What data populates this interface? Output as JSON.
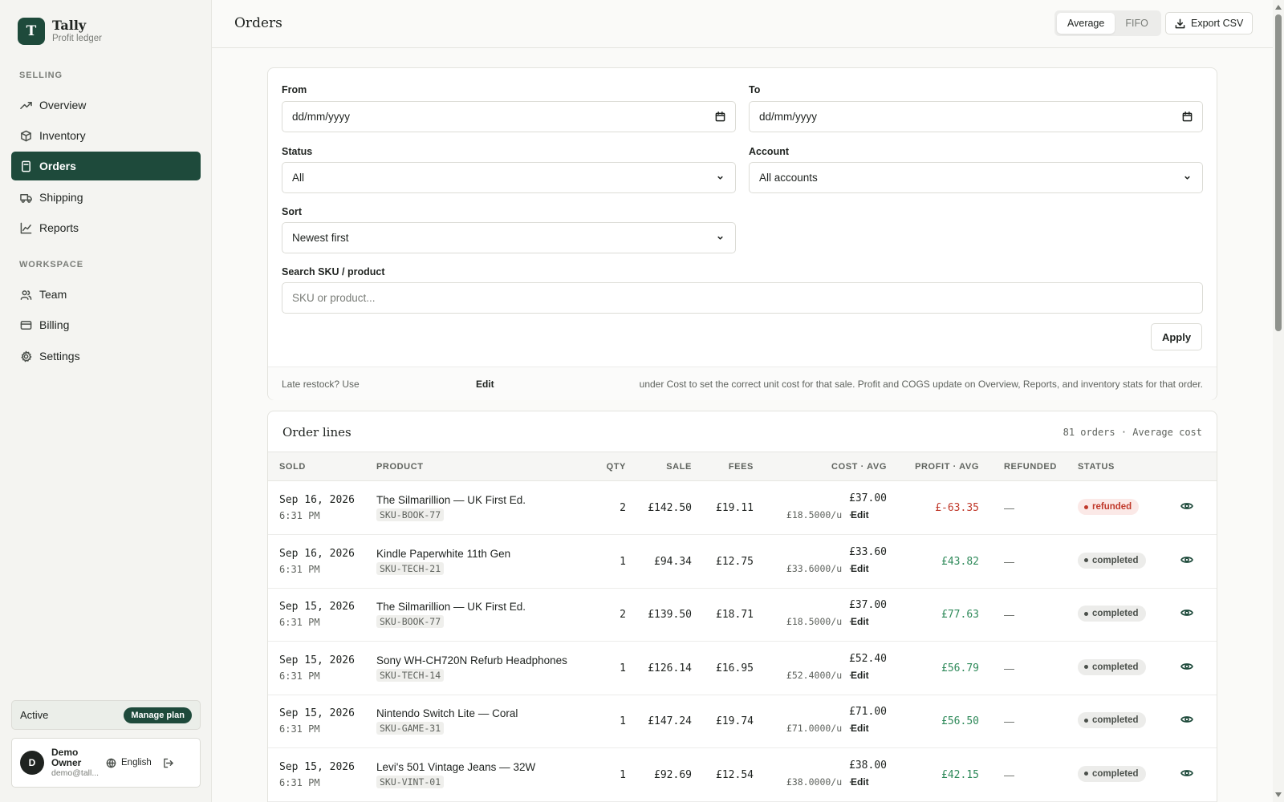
{
  "brand": {
    "logo_letter": "T",
    "name": "Tally",
    "subtitle": "Profit ledger"
  },
  "sidebar": {
    "section_selling": "SELLING",
    "section_workspace": "WORKSPACE",
    "items": [
      {
        "label": "Overview",
        "icon": "trending-up-icon"
      },
      {
        "label": "Inventory",
        "icon": "box-icon"
      },
      {
        "label": "Orders",
        "icon": "receipt-icon",
        "active": true
      },
      {
        "label": "Shipping",
        "icon": "truck-icon"
      },
      {
        "label": "Reports",
        "icon": "chart-icon"
      },
      {
        "label": "Team",
        "icon": "users-icon"
      },
      {
        "label": "Billing",
        "icon": "credit-card-icon"
      },
      {
        "label": "Settings",
        "icon": "gear-icon"
      }
    ],
    "plan": {
      "status": "Active",
      "manage_label": "Manage plan"
    },
    "user": {
      "initial": "D",
      "name": "Demo Owner",
      "email": "demo@tall...",
      "language": "English"
    }
  },
  "header": {
    "title": "Orders",
    "cost_modes": [
      "Average",
      "FIFO"
    ],
    "selected_mode": "Average",
    "export_label": "Export CSV"
  },
  "filters": {
    "from_label": "From",
    "from_placeholder": "dd/mm/yyyy",
    "to_label": "To",
    "to_placeholder": "dd/mm/yyyy",
    "status_label": "Status",
    "status_value": "All",
    "account_label": "Account",
    "account_value": "All accounts",
    "sort_label": "Sort",
    "sort_value": "Newest first",
    "search_label": "Search SKU / product",
    "search_placeholder": "SKU or product...",
    "apply_label": "Apply",
    "hint_prefix": "Late restock? Use",
    "hint_edit": "Edit",
    "hint_suffix": "under Cost to set the correct unit cost for that sale. Profit and COGS update on Overview, Reports, and inventory stats for that order."
  },
  "orders": {
    "title": "Order lines",
    "meta": "81 orders · Average cost",
    "columns": [
      "SOLD",
      "PRODUCT",
      "QTY",
      "SALE",
      "FEES",
      "COST · AVG",
      "PROFIT · AVG",
      "REFUNDED",
      "STATUS"
    ],
    "edit_label": "Edit",
    "rows": [
      {
        "date": "Sep 16, 2026",
        "time": "6:31 PM",
        "product": "The Silmarillion — UK First Ed.",
        "sku": "SKU-BOOK-77",
        "qty": "2",
        "sale": "£142.50",
        "fees": "£19.11",
        "cost": "£37.00",
        "unit_cost": "£18.5000/u ·",
        "profit": "£-63.35",
        "profit_negative": true,
        "refunded": "—",
        "status": "refunded"
      },
      {
        "date": "Sep 16, 2026",
        "time": "6:31 PM",
        "product": "Kindle Paperwhite 11th Gen",
        "sku": "SKU-TECH-21",
        "qty": "1",
        "sale": "£94.34",
        "fees": "£12.75",
        "cost": "£33.60",
        "unit_cost": "£33.6000/u ·",
        "profit": "£43.82",
        "profit_negative": false,
        "refunded": "—",
        "status": "completed"
      },
      {
        "date": "Sep 15, 2026",
        "time": "6:31 PM",
        "product": "The Silmarillion — UK First Ed.",
        "sku": "SKU-BOOK-77",
        "qty": "2",
        "sale": "£139.50",
        "fees": "£18.71",
        "cost": "£37.00",
        "unit_cost": "£18.5000/u ·",
        "profit": "£77.63",
        "profit_negative": false,
        "refunded": "—",
        "status": "completed"
      },
      {
        "date": "Sep 15, 2026",
        "time": "6:31 PM",
        "product": "Sony WH-CH720N Refurb Headphones",
        "sku": "SKU-TECH-14",
        "qty": "1",
        "sale": "£126.14",
        "fees": "£16.95",
        "cost": "£52.40",
        "unit_cost": "£52.4000/u ·",
        "profit": "£56.79",
        "profit_negative": false,
        "refunded": "—",
        "status": "completed"
      },
      {
        "date": "Sep 15, 2026",
        "time": "6:31 PM",
        "product": "Nintendo Switch Lite — Coral",
        "sku": "SKU-GAME-31",
        "qty": "1",
        "sale": "£147.24",
        "fees": "£19.74",
        "cost": "£71.00",
        "unit_cost": "£71.0000/u ·",
        "profit": "£56.50",
        "profit_negative": false,
        "refunded": "—",
        "status": "completed"
      },
      {
        "date": "Sep 15, 2026",
        "time": "6:31 PM",
        "product": "Levi's 501 Vintage Jeans — 32W",
        "sku": "SKU-VINT-01",
        "qty": "1",
        "sale": "£92.69",
        "fees": "£12.54",
        "cost": "£38.00",
        "unit_cost": "£38.0000/u ·",
        "profit": "£42.15",
        "profit_negative": false,
        "refunded": "—",
        "status": "completed"
      }
    ]
  },
  "colors": {
    "brand": "#1e4a3b",
    "profit_positive": "#2f8a5a",
    "profit_negative": "#c0392b",
    "refunded_badge_bg": "#fbe9e7",
    "refunded_badge_fg": "#c0392b",
    "completed_badge_bg": "#ececea",
    "completed_badge_fg": "#4b504b"
  }
}
